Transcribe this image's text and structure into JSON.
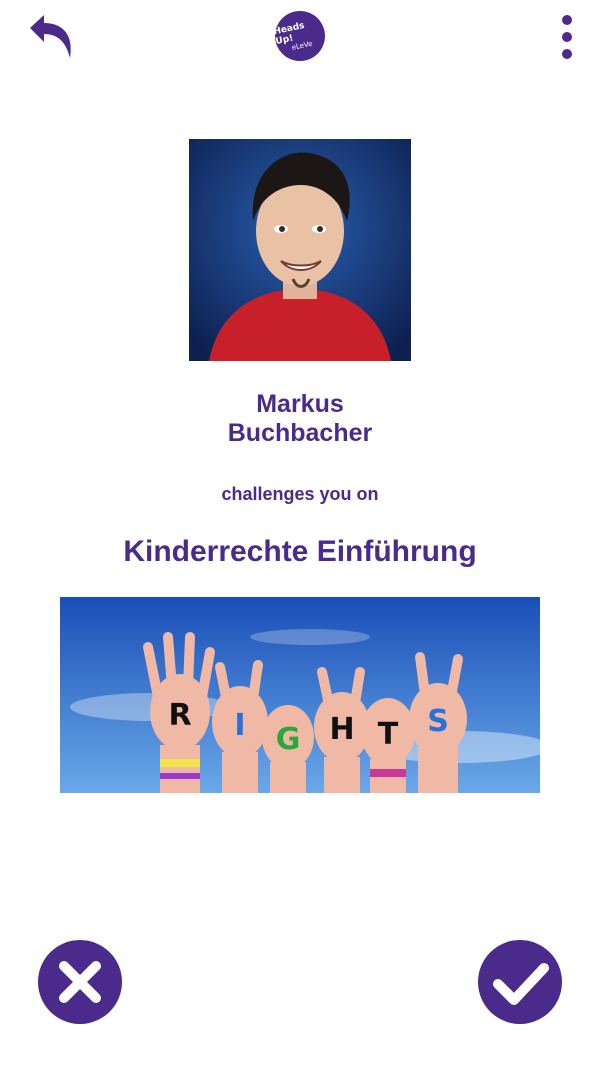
{
  "header": {
    "back_icon": "back-arrow-icon",
    "logo_line1": "Heads Up!",
    "logo_line2": "eLeVe",
    "menu_icon": "more-vertical-icon"
  },
  "challenge": {
    "challenger_first_name": "Markus",
    "challenger_last_name": "Buchbacher",
    "challenge_text": "challenges you on",
    "topic_title": "Kinderrechte Einführung",
    "topic_image_letters": [
      "R",
      "I",
      "G",
      "H",
      "T",
      "S"
    ]
  },
  "actions": {
    "decline_icon": "close-icon",
    "accept_icon": "checkmark-icon"
  },
  "colors": {
    "accent": "#4a2a8a",
    "background": "#ffffff"
  }
}
